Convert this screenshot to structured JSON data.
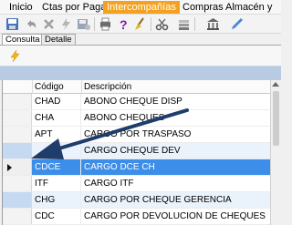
{
  "menu": {
    "items": [
      {
        "label": "Inicio"
      },
      {
        "label": "Ctas por Pagar"
      },
      {
        "label": "Intercompañías"
      },
      {
        "label": "Compras"
      },
      {
        "label": "Almacén y desp"
      }
    ],
    "active_index": 2,
    "active_color": "#f4a11f"
  },
  "tabs": [
    {
      "label": "Consulta",
      "selected": true
    },
    {
      "label": "Detalle",
      "selected": false
    }
  ],
  "grid": {
    "columns": [
      "Código",
      "Descripción"
    ],
    "rows": [
      {
        "code": "CHAD",
        "desc": "ABONO CHEQUE DISP"
      },
      {
        "code": "CHA",
        "desc": "ABONO CHEQUES"
      },
      {
        "code": "APT",
        "desc": "CARGO POR TRASPASO"
      },
      {
        "code": "",
        "desc": "CARGO CHEQUE DEV"
      },
      {
        "code": "CDCE",
        "desc": "CARGO DCE CH"
      },
      {
        "code": "ITF",
        "desc": "CARGO ITF"
      },
      {
        "code": "CHG",
        "desc": "CARGO POR CHEQUE GERENCIA"
      },
      {
        "code": "CDC",
        "desc": "CARGO POR DEVOLUCION DE CHEQUES"
      }
    ],
    "selected_index": 4,
    "selection_color": "#3d8ee8"
  },
  "annotation_arrow_color": "#1f3d6b",
  "icons": [
    "save-icon",
    "undo-icon",
    "delete-icon",
    "lightning-icon",
    "save-as-icon",
    "print-icon",
    "help-icon",
    "broom-icon",
    "cut-icon",
    "stack-icon",
    "bank-icon",
    "pen-icon",
    "lightning-icon"
  ]
}
